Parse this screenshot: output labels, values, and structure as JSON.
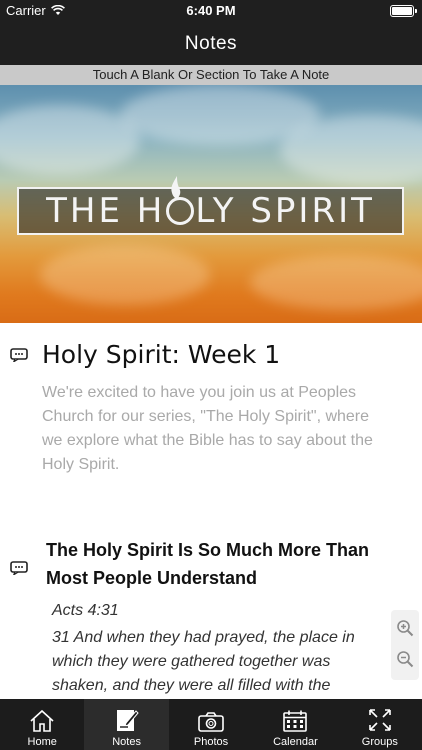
{
  "status_bar": {
    "carrier": "Carrier",
    "time": "6:40 PM"
  },
  "nav": {
    "title": "Notes"
  },
  "hint": {
    "text": "Touch A Blank Or Section To Take A Note"
  },
  "hero": {
    "banner_text_left": "THE H",
    "banner_text_right": "LY SPIRIT",
    "logo_text": "THE HOLY SPIRIT"
  },
  "content": {
    "title": "Holy Spirit: Week 1",
    "intro": "We're excited to have you join us at Peoples Church for our series, \"The Holy Spirit\", where we explore what the Bible has to say about the Holy Spirit.",
    "heading": "The Holy Spirit Is So Much More Than Most People Understand",
    "verse_ref": "Acts 4:31",
    "verse_text": "31 And when they had prayed, the place in which they were gathered together was shaken, and they were all filled with the"
  },
  "tabs": [
    {
      "label": "Home",
      "icon": "home-icon",
      "active": false
    },
    {
      "label": "Notes",
      "icon": "notes-icon",
      "active": true
    },
    {
      "label": "Photos",
      "icon": "camera-icon",
      "active": false
    },
    {
      "label": "Calendar",
      "icon": "calendar-icon",
      "active": false
    },
    {
      "label": "Groups",
      "icon": "groups-icon",
      "active": false
    }
  ],
  "colors": {
    "nav_background": "#1f1f1f",
    "hint_background": "#c9c9c9",
    "intro_text": "#a9a9a9"
  }
}
